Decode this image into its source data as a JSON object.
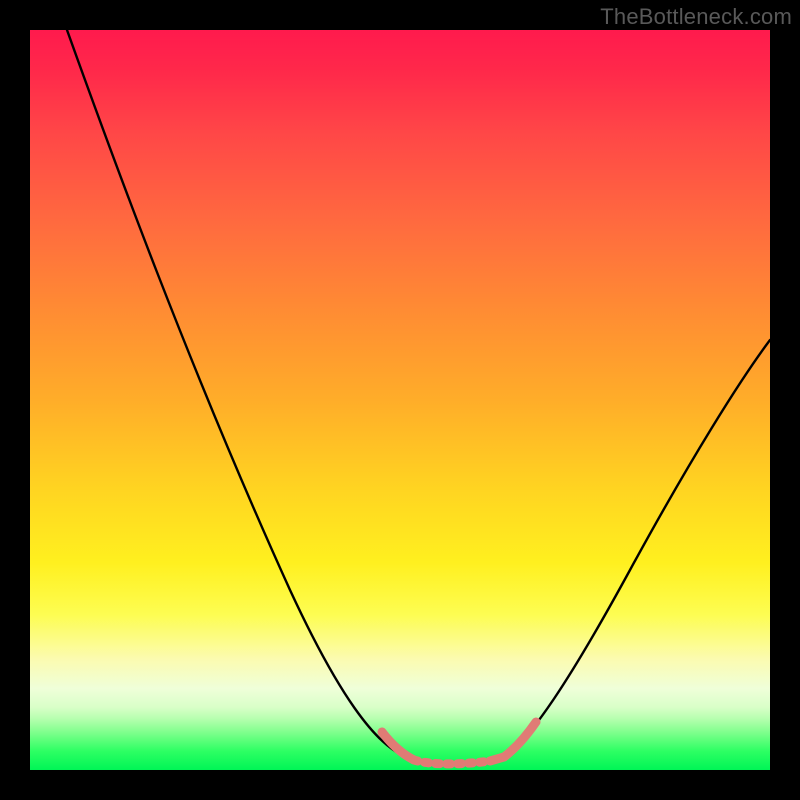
{
  "watermark": "TheBottleneck.com",
  "colors": {
    "curve_black": "#000000",
    "curve_accent": "#e07b75",
    "green_base": "#00f556"
  },
  "chart_data": {
    "type": "line",
    "title": "",
    "xlabel": "",
    "ylabel": "",
    "xlim": [
      0,
      100
    ],
    "ylim": [
      0,
      100
    ],
    "series": [
      {
        "name": "left-branch",
        "x": [
          5,
          10,
          15,
          20,
          25,
          30,
          35,
          40,
          45,
          48,
          50,
          52
        ],
        "y": [
          100,
          90,
          79,
          68,
          57,
          46,
          35,
          24,
          13,
          6,
          3,
          1
        ]
      },
      {
        "name": "valley-floor",
        "x": [
          52,
          55,
          58,
          61,
          64
        ],
        "y": [
          1,
          0.5,
          0.5,
          0.7,
          1.5
        ]
      },
      {
        "name": "right-branch",
        "x": [
          64,
          68,
          74,
          80,
          86,
          92,
          98,
          100
        ],
        "y": [
          1.5,
          6,
          14,
          23,
          32,
          41,
          50,
          53
        ]
      }
    ],
    "annotations": [
      {
        "name": "accent-left-slope",
        "x_range": [
          48,
          52
        ],
        "color": "#e07b75"
      },
      {
        "name": "accent-valley-floor",
        "x_range": [
          52,
          64
        ],
        "color": "#e07b75"
      },
      {
        "name": "accent-right-slope",
        "x_range": [
          64,
          68
        ],
        "color": "#e07b75"
      }
    ]
  }
}
